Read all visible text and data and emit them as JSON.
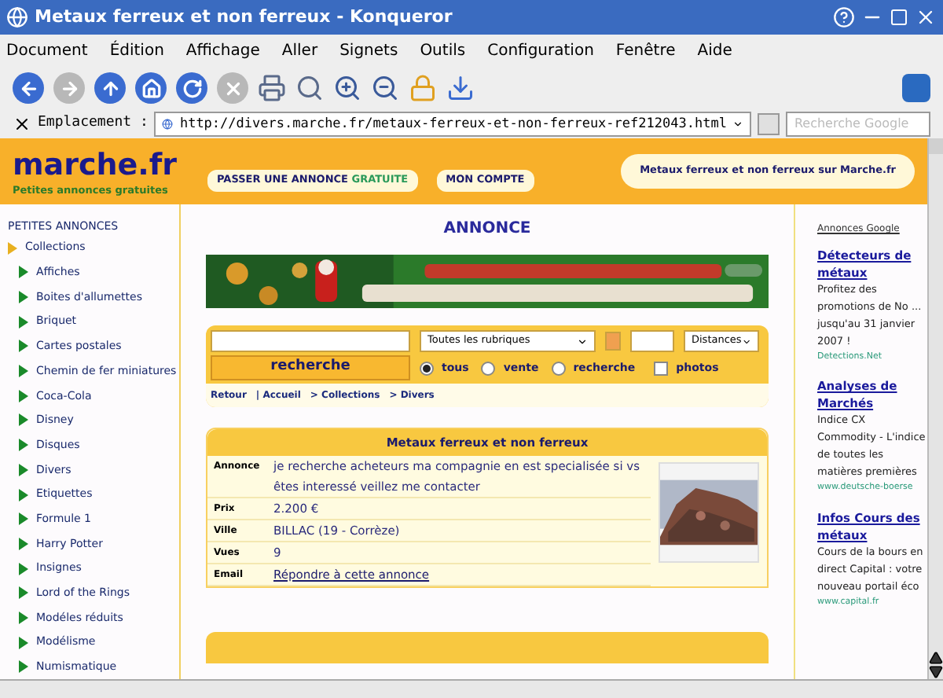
{
  "window": {
    "title": "Metaux ferreux et non ferreux - Konqueror"
  },
  "menu": [
    "Document",
    "Édition",
    "Affichage",
    "Aller",
    "Signets",
    "Outils",
    "Configuration",
    "Fenêtre",
    "Aide"
  ],
  "location": {
    "label": "Emplacement :",
    "url": "http://divers.marche.fr/metaux-ferreux-et-non-ferreux-ref212043.html",
    "search_placeholder": "Recherche Google"
  },
  "header": {
    "logo": "marche.fr",
    "tagline": "Petites annonces gratuites",
    "buttons": [
      {
        "label": "PASSER UNE ANNONCE",
        "highlight": "GRATUITE"
      },
      {
        "label": "MON COMPTE"
      }
    ],
    "slogan": "Metaux ferreux et non ferreux sur Marche.fr"
  },
  "sidebar": {
    "heading": "PETITES ANNONCES",
    "tree": [
      {
        "label": "Collections",
        "expanded": true,
        "children": [
          {
            "label": "Affiches"
          },
          {
            "label": "Boites d'allumettes"
          },
          {
            "label": "Briquet"
          },
          {
            "label": "Cartes postales"
          },
          {
            "label": "Chemin de fer miniatures"
          },
          {
            "label": "Coca-Cola"
          },
          {
            "label": "Disney"
          },
          {
            "label": "Disques"
          },
          {
            "label": "Divers"
          },
          {
            "label": "Etiquettes"
          },
          {
            "label": "Formule 1"
          },
          {
            "label": "Harry Potter"
          },
          {
            "label": "Insignes"
          },
          {
            "label": "Lord of the Rings"
          },
          {
            "label": "Modéles réduits"
          },
          {
            "label": "Modélisme"
          },
          {
            "label": "Numismatique"
          }
        ]
      }
    ]
  },
  "main": {
    "heading": "ANNONCE",
    "search": {
      "category": "Toutes les rubriques",
      "distance": "Distances",
      "button": "recherche",
      "options": [
        {
          "label": "tous",
          "selected": true
        },
        {
          "label": "vente",
          "selected": false
        },
        {
          "label": "recherche",
          "selected": false
        }
      ],
      "photos": {
        "label": "photos",
        "checked": false
      },
      "breadcrumb": [
        "Retour",
        "| Accueil",
        "> Collections",
        "> Divers"
      ]
    },
    "ad": {
      "title": "Metaux ferreux et non ferreux",
      "rows": [
        {
          "label": "Annonce",
          "value": "je recherche acheteurs ma compagnie en est specialisée si vs êtes interessé veillez me contacter",
          "kind": "text"
        },
        {
          "label": "Prix",
          "value": "2.200 €",
          "kind": "text"
        },
        {
          "label": "Ville",
          "value": "BILLAC (19 - Corrèze)",
          "kind": "text"
        },
        {
          "label": "Vues",
          "value": "9",
          "kind": "text"
        },
        {
          "label": "Email",
          "value": "Répondre à cette annonce",
          "kind": "link"
        }
      ]
    }
  },
  "google": {
    "heading": "Annonces Google",
    "ads": [
      {
        "title": "Détecteurs de métaux",
        "text": "Profitez des promotions de No ... jusqu'au 31 janvier 2007 !",
        "url": "Detections.Net"
      },
      {
        "title": "Analyses de Marchés",
        "text": "Indice CX Commodity - L'indice de toutes les matières premières",
        "url": "www.deutsche-boerse"
      },
      {
        "title": "Infos Cours des métaux",
        "text": "Cours de la bours en direct Capital : votre nouveau portail éco",
        "url": "www.capital.fr"
      }
    ]
  }
}
